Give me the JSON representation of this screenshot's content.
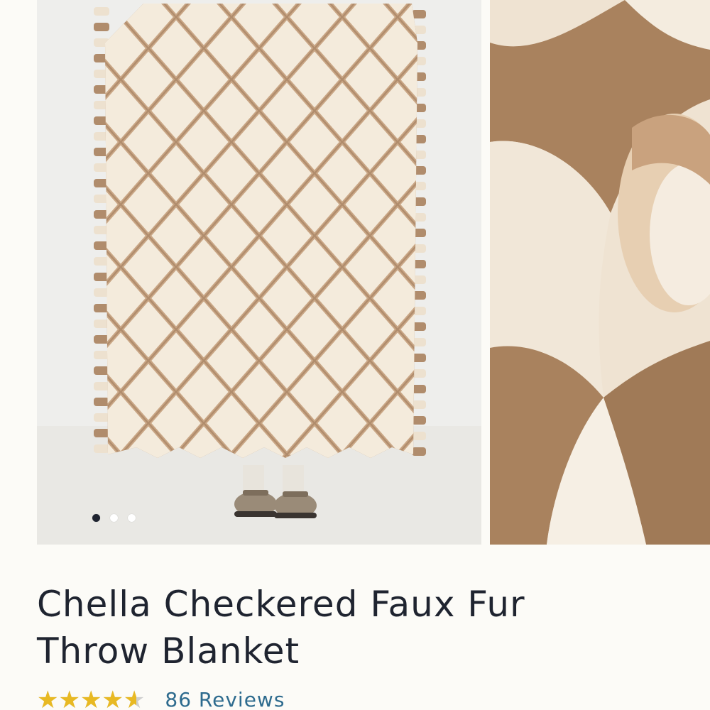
{
  "product": {
    "title_line1": "Chella Checkered Faux Fur",
    "title_line2": "Throw Blanket",
    "rating_value": 4.6,
    "rating_stars": "★★★★★",
    "reviews_label": "86 Reviews"
  },
  "gallery": {
    "image_count": 3,
    "active_index": 0,
    "main_image_icon": "product-photo",
    "detail_image_icon": "product-detail-photo"
  },
  "colors": {
    "accent_star": "#e8b923",
    "link": "#2e6b8e",
    "text": "#1f2430",
    "blanket_tan": "#b08c6c",
    "blanket_cream": "#f4ebdc"
  }
}
